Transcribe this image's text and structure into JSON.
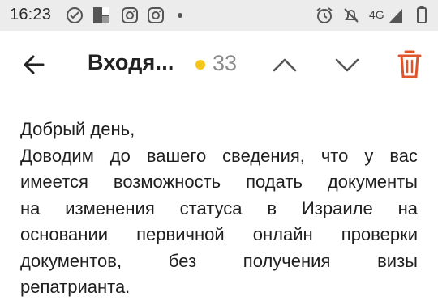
{
  "status_bar": {
    "time": "16:23",
    "network": "4G",
    "icons": [
      "sync-icon",
      "app-icon",
      "instagram-icon",
      "instagram-icon",
      "dot-icon",
      "alarm-icon",
      "mute-icon",
      "signal-icon",
      "battery-icon"
    ]
  },
  "toolbar": {
    "title": "Входя...",
    "unread_count": "33",
    "dot_color": "#f5c518",
    "trash_color": "#e0542b"
  },
  "message": {
    "lines": [
      "Добрый день,",
      "Доводим до вашего сведения, что у вас",
      "имеется возможность подать документы",
      "на изменения статуса в Израиле на",
      "основании первичной онлайн проверки",
      "документов, без получения визы",
      "репатрианта."
    ]
  }
}
